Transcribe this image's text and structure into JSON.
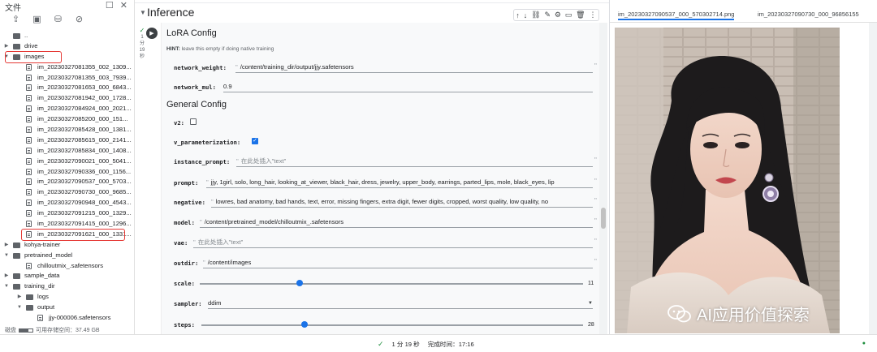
{
  "files": {
    "title": "文件",
    "tree": [
      {
        "label": "..",
        "icon": "folder-up",
        "level": 0,
        "type": "up"
      },
      {
        "label": "drive",
        "level": 0,
        "type": "folder",
        "state": "collapsed"
      },
      {
        "label": "images",
        "level": 0,
        "type": "folder",
        "state": "expanded",
        "highlighted": true
      },
      {
        "label": "im_20230327081355_002_1309...",
        "level": 1,
        "type": "file"
      },
      {
        "label": "im_20230327081355_003_7939...",
        "level": 1,
        "type": "file"
      },
      {
        "label": "im_20230327081653_000_6843...",
        "level": 1,
        "type": "file"
      },
      {
        "label": "im_20230327081942_000_1728...",
        "level": 1,
        "type": "file"
      },
      {
        "label": "im_20230327084924_000_2021...",
        "level": 1,
        "type": "file"
      },
      {
        "label": "im_20230327085200_000_151...",
        "level": 1,
        "type": "file"
      },
      {
        "label": "im_20230327085428_000_1381...",
        "level": 1,
        "type": "file"
      },
      {
        "label": "im_20230327085615_000_2141...",
        "level": 1,
        "type": "file"
      },
      {
        "label": "im_20230327085834_000_1408...",
        "level": 1,
        "type": "file"
      },
      {
        "label": "im_20230327090021_000_5041...",
        "level": 1,
        "type": "file"
      },
      {
        "label": "im_20230327090336_000_1156...",
        "level": 1,
        "type": "file"
      },
      {
        "label": "im_20230327090537_000_5703...",
        "level": 1,
        "type": "file"
      },
      {
        "label": "im_20230327090730_000_9685...",
        "level": 1,
        "type": "file"
      },
      {
        "label": "im_20230327090948_000_4543...",
        "level": 1,
        "type": "file"
      },
      {
        "label": "im_20230327091215_000_1329...",
        "level": 1,
        "type": "file"
      },
      {
        "label": "im_20230327091415_000_1296...",
        "level": 1,
        "type": "file"
      },
      {
        "label": "im_20230327091621_000_1331...",
        "level": 1,
        "type": "file",
        "highlighted": true
      },
      {
        "label": "kohya-trainer",
        "level": 0,
        "type": "folder",
        "state": "collapsed"
      },
      {
        "label": "pretrained_model",
        "level": 0,
        "type": "folder",
        "state": "expanded"
      },
      {
        "label": "chilloutmix_.safetensors",
        "level": 1,
        "type": "file"
      },
      {
        "label": "sample_data",
        "level": 0,
        "type": "folder",
        "state": "collapsed"
      },
      {
        "label": "training_dir",
        "level": 0,
        "type": "folder",
        "state": "expanded"
      },
      {
        "label": "logs",
        "level": 1,
        "type": "folder",
        "state": "collapsed"
      },
      {
        "label": "output",
        "level": 1,
        "type": "folder",
        "state": "expanded"
      },
      {
        "label": "jjy-000006.safetensors",
        "level": 2,
        "type": "file"
      }
    ],
    "disk_label": "磁盘",
    "disk_free": "可用存储空间：37.49 GB"
  },
  "notebook": {
    "section_title": "Inference",
    "cell_status_time": "1\n分\n19\n秒",
    "lora_heading": "LoRA Config",
    "hint_label": "HINT:",
    "hint_text": "leave this empty if doing native training",
    "general_heading": "General Config",
    "fields": {
      "network_weight": {
        "label": "network_weight:",
        "value": "/content/training_dir/output/jjy.safetensors"
      },
      "network_mul": {
        "label": "network_mul:",
        "value": "0.9"
      },
      "v2": {
        "label": "v2:",
        "checked": false
      },
      "v_parameterization": {
        "label": "v_parameterization:",
        "checked": true
      },
      "instance_prompt": {
        "label": "instance_prompt:",
        "placeholder": "在此处插入\"text\""
      },
      "prompt": {
        "label": "prompt:",
        "value": "jjy, 1girl, solo, long_hair, looking_at_viewer, black_hair, dress, jewelry, upper_body, earrings, parted_lips, mole, black_eyes, lip"
      },
      "negative": {
        "label": "negative:",
        "value": "lowres, bad anatomy, bad hands, text, error, missing fingers, extra digit, fewer digits, cropped, worst quality, low quality, no"
      },
      "model": {
        "label": "model:",
        "value": "/content/pretrained_model/chilloutmix_.safetensors"
      },
      "vae": {
        "label": "vae:",
        "placeholder": "在此处插入\"text\""
      },
      "outdir": {
        "label": "outdir:",
        "value": "/content/images"
      },
      "scale": {
        "label": "scale:",
        "value": "11",
        "fraction": 0.26
      },
      "sampler": {
        "label": "sampler:",
        "value": "ddim"
      },
      "steps": {
        "label": "steps:",
        "value": "28",
        "fraction": 0.27
      }
    }
  },
  "viewer": {
    "tab_active": "im_20230327090537_000_570302714.png",
    "tab_other": "im_20230327090730_000_96856155",
    "watermark": "AI应用价值探索"
  },
  "status": {
    "elapsed": "1 分 19 秒",
    "completed": "完成时间：17:16",
    "colors": {
      "ok": "#1e8e3e",
      "accent": "#1a73e8",
      "highlight": "#e53935"
    }
  }
}
